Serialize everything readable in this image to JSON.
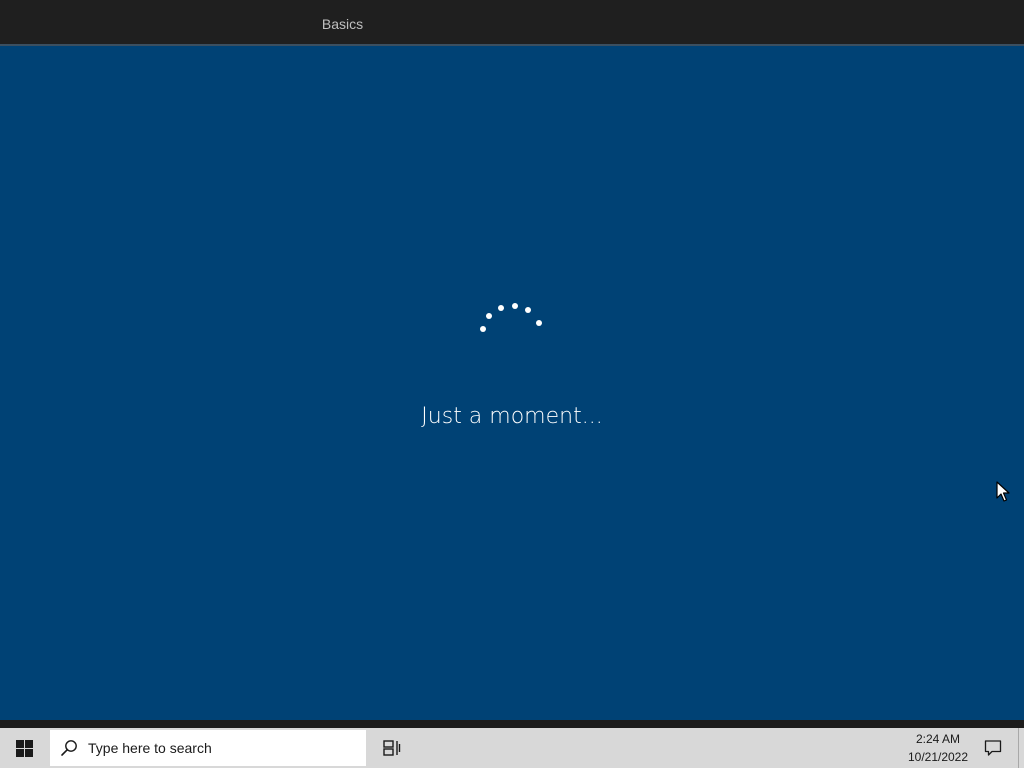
{
  "header": {
    "tabs": [
      {
        "label": "Basics",
        "active": true
      }
    ]
  },
  "main": {
    "loading_text": "Just a moment..."
  },
  "taskbar": {
    "start_icon": "windows-logo-icon",
    "search": {
      "icon": "search-icon",
      "placeholder": "Type here to search"
    },
    "task_view_icon": "task-view-icon",
    "clock": {
      "time": "2:24 AM",
      "date": "10/21/2022"
    },
    "notification_icon": "action-center-icon"
  },
  "colors": {
    "background": "#004275",
    "header": "#1f1f1f",
    "taskbar": "#d8d8d8",
    "text": "#ffffff"
  }
}
